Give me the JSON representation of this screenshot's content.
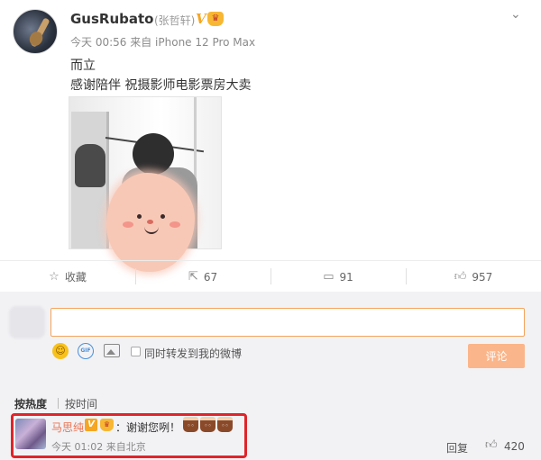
{
  "post": {
    "username": "GusRubato",
    "realname": "(张哲轩)",
    "verified_badge": "V",
    "time": "今天 00:56",
    "source": "来自 iPhone 12 Pro Max",
    "line1": "而立",
    "line2": "感谢陪伴 祝摄影师电影票房大卖"
  },
  "actions": {
    "favorite_label": "收藏",
    "repost_count": "67",
    "comment_count": "91",
    "like_count": "957"
  },
  "composer": {
    "input_value": "",
    "gif_label": "GIF",
    "repost_option": "同时转发到我的微博",
    "submit_label": "评论"
  },
  "sort": {
    "by_hot": "按热度",
    "by_time": "按时间"
  },
  "comment": {
    "name": "马思纯",
    "verified_badge": "V",
    "text": "：谢谢您咧！",
    "time": "今天 01:02",
    "source": "来自北京",
    "reply_label": "回复",
    "like_count": "420"
  },
  "icons": {
    "more": "chevron-down-icon",
    "favorite": "star-icon",
    "repost": "repost-icon",
    "comment": "comment-icon",
    "like": "thumb-up-icon",
    "emoji": "emoji-icon",
    "gif": "gif-icon",
    "image": "image-icon"
  },
  "colors": {
    "accent_orange": "#eb7350",
    "submit_disabled": "#fbb58a",
    "highlight_border": "#e0242a",
    "verified_gold": "#f5a623"
  }
}
